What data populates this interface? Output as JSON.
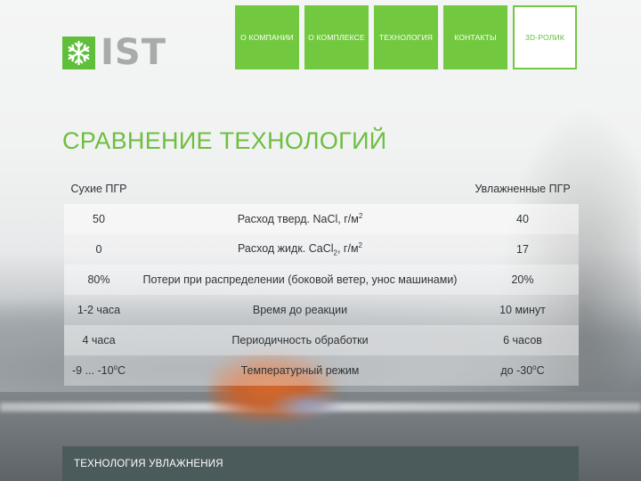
{
  "logo": {
    "text": "IST",
    "icon": "snowflake-icon",
    "brand_color": "#5fbf3a"
  },
  "nav": {
    "items": [
      {
        "label": "О КОМПАНИИ"
      },
      {
        "label": "О КОМПЛЕКСЕ"
      },
      {
        "label": "ТЕХНОЛОГИЯ"
      },
      {
        "label": "КОНТАКТЫ"
      },
      {
        "label": "3D-РОЛИК"
      }
    ]
  },
  "page": {
    "title": "СРАВНЕНИЕ ТЕХНОЛОГИЙ"
  },
  "compare": {
    "col_left": "Сухие ПГР",
    "col_right": "Увлажненные ПГР",
    "rows": [
      {
        "left": "50",
        "param": "Расход тверд. NaCl, г/м",
        "param_sup": "2",
        "right": "40"
      },
      {
        "left": "0",
        "param": "Расход жидк. CaCl",
        "param_sub": "2",
        "param_rest": ", г/м",
        "param_sup": "2",
        "right": "17"
      },
      {
        "left": "80%",
        "param": "Потери при распределении (боковой ветер, унос машинами)",
        "right": "20%"
      },
      {
        "left": "1-2 часа",
        "param": "Время до реакции",
        "right": "10 минут"
      },
      {
        "left": "4 часа",
        "param": "Периодичность обработки",
        "right": "6 часов"
      },
      {
        "left": "-9 ... -10",
        "left_sup": "о",
        "left_rest": "С",
        "param": "Температурный режим",
        "right": "до -30",
        "right_sup": "о",
        "right_rest": "С"
      }
    ]
  },
  "footer": {
    "label": "ТЕХНОЛОГИЯ УВЛАЖНЕНИЯ"
  },
  "colors": {
    "accent": "#72c93f",
    "title": "#6dbf3f",
    "footer_bg": "#4b5a5b"
  }
}
